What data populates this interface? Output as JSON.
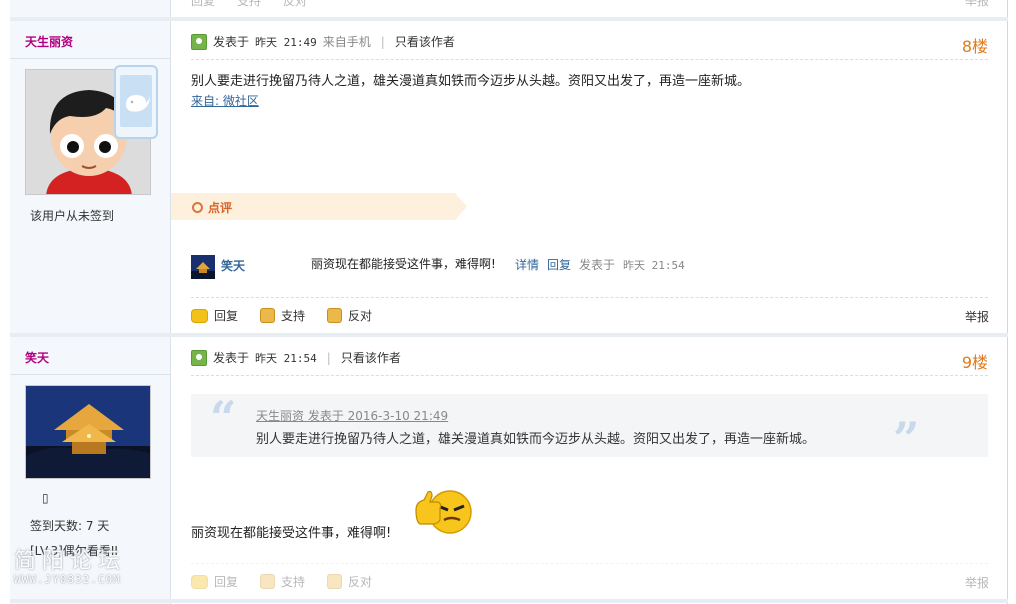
{
  "top_partial": {
    "actions": [
      "回复",
      "支持",
      "反对"
    ],
    "report": "举报"
  },
  "post8": {
    "author": "天生丽资",
    "sign_status": "该用户从未签到",
    "meta_posted": "发表于",
    "meta_time": "昨天 21:49",
    "meta_source": "来自手机",
    "meta_only_author": "只看该作者",
    "floor": "8楼",
    "body": "别人要走进行挽留乃待人之道，雄关漫道真如铁而今迈步从头越。资阳又出发了，再造一座新城。",
    "from_link": "来自: 微社区",
    "comment_section_label": "点评",
    "comment": {
      "user": "笑天",
      "text": "丽资现在都能接受这件事，难得啊!",
      "detail_link": "详情",
      "reply_link": "回复",
      "posted_label": "发表于",
      "time": "昨天 21:54"
    },
    "actions": {
      "reply": "回复",
      "support": "支持",
      "oppose": "反对",
      "report": "举报"
    }
  },
  "post9": {
    "author": "笑天",
    "sign_days": "签到天数: 7 天",
    "level": "[LV.3]偶尔看看II",
    "meta_posted": "发表于",
    "meta_time": "昨天 21:54",
    "meta_only_author": "只看该作者",
    "floor": "9楼",
    "quote": {
      "header": "天生丽资 发表于 2016-3-10 21:49",
      "text": "别人要走进行挽留乃待人之道，雄关漫道真如铁而今迈步从头越。资阳又出发了，再造一座新城。"
    },
    "body": "丽资现在都能接受这件事，难得啊!",
    "actions": {
      "reply": "回复",
      "support": "支持",
      "oppose": "反对",
      "report": "举报"
    }
  },
  "watermark": {
    "title": "简阳论坛",
    "url": "WWW.JY0832.COM"
  },
  "colors": {
    "username": "#b0007f",
    "floor": "#e07b1c",
    "link": "#336699",
    "comment_accent": "#d9622b"
  }
}
